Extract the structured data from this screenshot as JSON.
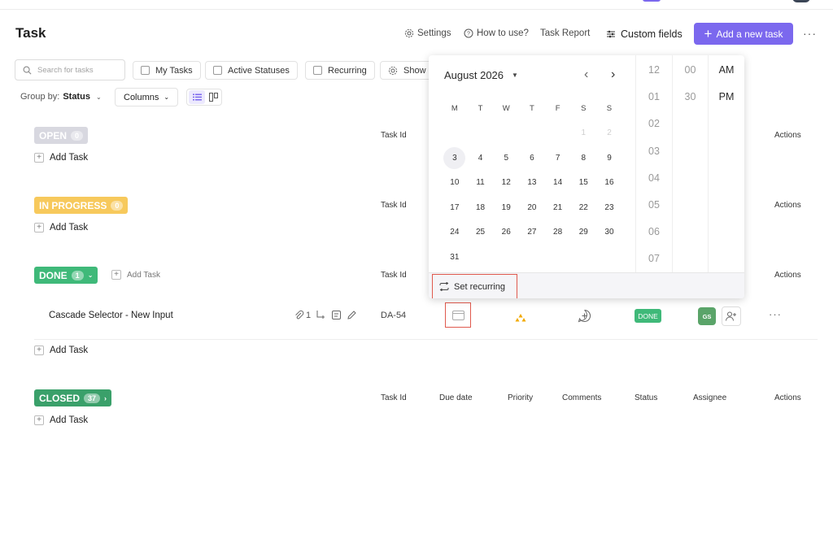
{
  "page": {
    "title": "Task"
  },
  "header": {
    "settings": "Settings",
    "how_to_use": "How to use?",
    "task_report": "Task Report",
    "custom_fields": "Custom fields",
    "add_task": "Add a new task"
  },
  "filters": {
    "search_placeholder": "Search for tasks",
    "my_tasks": "My Tasks",
    "active_statuses": "Active Statuses",
    "recurring": "Recurring",
    "show": "Show",
    "group_by_label": "Group by:",
    "group_by_value": "Status",
    "columns": "Columns"
  },
  "columns": {
    "task_id": "Task Id",
    "due_date": "Due date",
    "priority": "Priority",
    "comments": "Comments",
    "status": "Status",
    "assignee": "Assignee",
    "actions": "Actions"
  },
  "groups": [
    {
      "name": "OPEN",
      "count": "0",
      "color": "#d8d8e0"
    },
    {
      "name": "IN PROGRESS",
      "count": "0",
      "color": "#f7c95c"
    },
    {
      "name": "DONE",
      "count": "1",
      "color": "#3fb979"
    },
    {
      "name": "CLOSED",
      "count": "37",
      "color": "#3aa06a"
    }
  ],
  "add_task_label": "Add Task",
  "task": {
    "name": "Cascade Selector - New Input",
    "attachments": "1",
    "id": "DA-54",
    "status": "DONE",
    "assignee_initials": "GS"
  },
  "calendar": {
    "month": "August 2026",
    "weekdays": [
      "M",
      "T",
      "W",
      "T",
      "F",
      "S",
      "S"
    ],
    "leading": [
      "1",
      "2"
    ],
    "days": [
      "3",
      "4",
      "5",
      "6",
      "7",
      "8",
      "9",
      "10",
      "11",
      "12",
      "13",
      "14",
      "15",
      "16",
      "17",
      "18",
      "19",
      "20",
      "21",
      "22",
      "23",
      "24",
      "25",
      "26",
      "27",
      "28",
      "29",
      "30",
      "31"
    ],
    "selected": "3",
    "hours": [
      "12",
      "01",
      "02",
      "03",
      "04",
      "05",
      "06",
      "07"
    ],
    "minutes": [
      "00",
      "30"
    ],
    "ampm": [
      "AM",
      "PM"
    ],
    "set_recurring": "Set recurring"
  },
  "colors": {
    "accent": "#7b68ee",
    "highlight": "#e05a4e"
  }
}
